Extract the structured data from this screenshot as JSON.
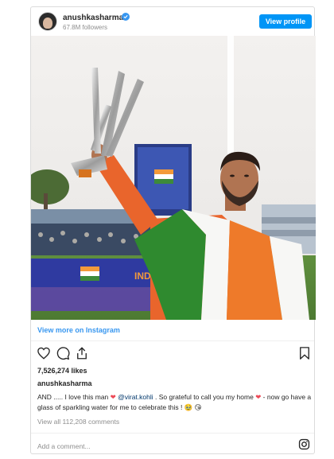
{
  "post": {
    "username": "anushkasharma",
    "followers": "67.8M followers",
    "view_profile_label": "View profile",
    "view_more_label": "View more on Instagram",
    "likes": "7,526,274 likes",
    "author": "anushkasharma",
    "caption": {
      "part1": "AND ..... I love this man ",
      "heart1": "❤",
      "mention": " @virat.kohli",
      "part2": " . So grateful to call you my home ",
      "heart2": "❤",
      "part3": " - now go have a glass of sparkling water for me to celebrate this ! ",
      "emoji": "🥹 😘"
    },
    "view_comments": "View all 112,208 comments",
    "add_comment_placeholder": "Add a comment...",
    "photo_banner_text": "INDIA"
  },
  "colors": {
    "primary_blue": "#0095f6",
    "link_blue": "#3897f0",
    "muted": "#8e8e8e",
    "text": "#262626",
    "heart": "#ed4956"
  },
  "icons": [
    "verified-badge-icon",
    "heart-icon",
    "comment-icon",
    "share-icon",
    "bookmark-icon",
    "instagram-icon"
  ]
}
